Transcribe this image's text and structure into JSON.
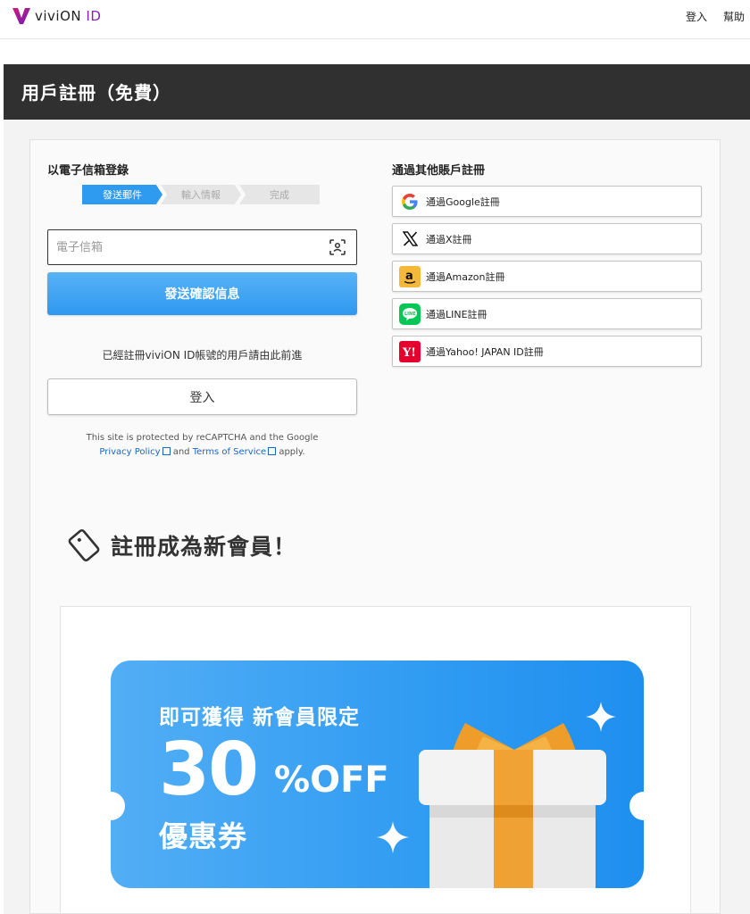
{
  "header": {
    "logo_text": "viviON",
    "logo_id": "ID",
    "login_link": "登入",
    "help_link": "幫助"
  },
  "page": {
    "title": "用戶註冊（免費）"
  },
  "email_section": {
    "title": "以電子信箱登錄",
    "steps": [
      "發送郵件",
      "輸入情報",
      "完成"
    ],
    "email_placeholder": "電子信箱",
    "send_button": "發送確認信息",
    "already_text": "已經註冊viviON ID帳號的用戶請由此前進",
    "login_button": "登入",
    "recaptcha_line1": "This site is protected by reCAPTCHA and the Google",
    "privacy_link": "Privacy Policy",
    "and_text": "and",
    "terms_link": "Terms of Service",
    "apply_text": "apply."
  },
  "sns_section": {
    "title": "通過其他賬戶註冊",
    "buttons": [
      {
        "label": "通過Google註冊",
        "icon": "google-icon"
      },
      {
        "label": "通過X註冊",
        "icon": "x-icon"
      },
      {
        "label": "通過Amazon註冊",
        "icon": "amazon-icon"
      },
      {
        "label": "通過LINE註冊",
        "icon": "line-icon"
      },
      {
        "label": "通過Yahoo! JAPAN ID註冊",
        "icon": "yahoo-icon"
      }
    ]
  },
  "promo": {
    "title": "註冊成為新會員！",
    "coupon_line1": "即可獲得 新會員限定",
    "coupon_number": "30",
    "coupon_off": "%OFF",
    "coupon_line3": "優惠券"
  },
  "colors": {
    "accent_blue": "#2f9bf0",
    "title_bar": "#303030",
    "brand_purple": "#8a1fb5"
  }
}
